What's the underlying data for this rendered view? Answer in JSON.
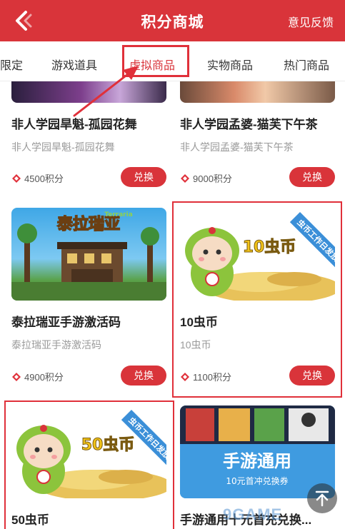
{
  "header": {
    "title": "积分商城",
    "feedback_label": "意见反馈"
  },
  "tabs": [
    {
      "label": "限定"
    },
    {
      "label": "游戏道具"
    },
    {
      "label": "虚拟商品",
      "active": true
    },
    {
      "label": "实物商品"
    },
    {
      "label": "热门商品"
    }
  ],
  "colors": {
    "accent": "#d9343a",
    "highlight": "#e0303a"
  },
  "products": [
    {
      "title": "非人学园旱魁-孤园花舞",
      "subtitle": "非人学园旱魁-孤园花舞",
      "points": "4500积分",
      "button": "兑换"
    },
    {
      "title": "非人学园孟婆-猫芙下午茶",
      "subtitle": "非人学园孟婆-猫芙下午茶",
      "points": "9000积分",
      "button": "兑换"
    },
    {
      "title": "泰拉瑞亚手游激活码",
      "subtitle": "泰拉瑞亚手游激活码",
      "points": "4900积分",
      "button": "兑换",
      "image_text": "泰拉瑞亚",
      "image_subtext": "Terraria"
    },
    {
      "title": "10虫币",
      "subtitle": "10虫币",
      "points": "1100积分",
      "button": "兑换",
      "image_text": "10虫币",
      "ribbon": "虫币工作日发放"
    },
    {
      "title": "50虫币",
      "image_text": "50虫币",
      "ribbon": "虫币工作日发放"
    },
    {
      "title": "手游通用十元首充兑换...",
      "image_text": "手游通用",
      "image_subtext": "10元首冲兑换券"
    }
  ],
  "watermark": "9GAME",
  "icons": {
    "back": "chevron-left-icon",
    "coin": "coin-icon",
    "scroll_top": "arrow-up-icon"
  }
}
